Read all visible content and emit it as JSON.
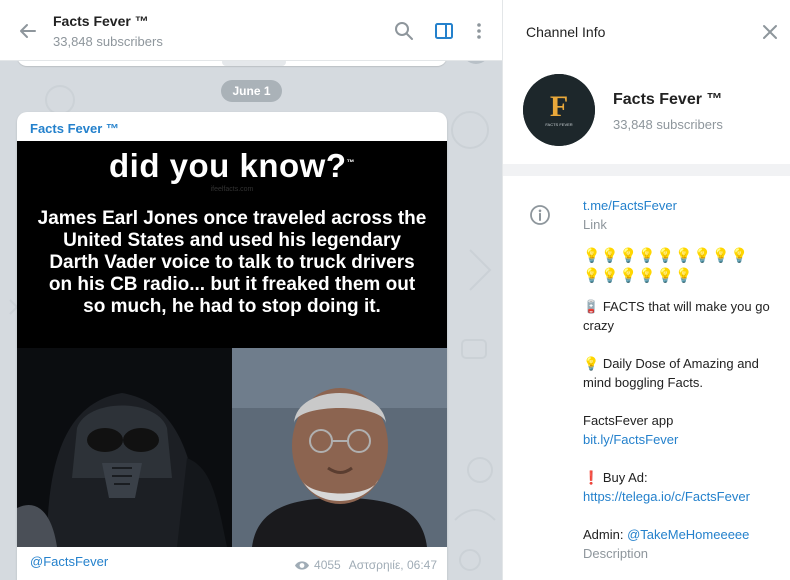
{
  "chat": {
    "title": "Facts Fever ™",
    "subscribers": "33,848 subscribers",
    "date_separator": "June 1"
  },
  "message": {
    "author": "Facts Fever ™",
    "image_headline": "did you know?",
    "image_body": "James Earl Jones once traveled across the United States and used his legendary Darth Vader voice to talk to truck drivers on his CB radio... but it freaked them out so much, he had to stop doing it.",
    "signature": "@FactsFever",
    "views": "4055",
    "time": "Αστσρηιίε, 06:47"
  },
  "info_panel": {
    "title": "Channel Info",
    "name": "Facts Fever ™",
    "subscribers": "33,848 subscribers",
    "avatar_letter": "F",
    "avatar_caption": "FACTS FEVER",
    "link": "t.me/FactsFever",
    "link_label": "Link",
    "bulbs_row1": "💡💡💡💡💡💡💡💡💡",
    "bulbs_row2": "💡💡💡💡💡💡",
    "desc_line1": "FACTS that will make you go crazy",
    "desc_line1_icon": "🪫",
    "desc_line2": "Daily Dose of Amazing and mind boggling Facts.",
    "desc_line2_icon": "💡",
    "app_label": "FactsFever app",
    "app_link": "bit.ly/FactsFever",
    "ad_label": "Buy  Ad:",
    "ad_icon": "❗",
    "ad_link": "https://telega.io/c/FactsFever",
    "admin_label": "Admin: ",
    "admin_link": "@TakeMeHomeeeee",
    "description_label": "Description"
  },
  "colors": {
    "accent": "#2481cc",
    "chat_bg": "#d5dadf",
    "sidebar_toggle_active": "#2481cc"
  }
}
